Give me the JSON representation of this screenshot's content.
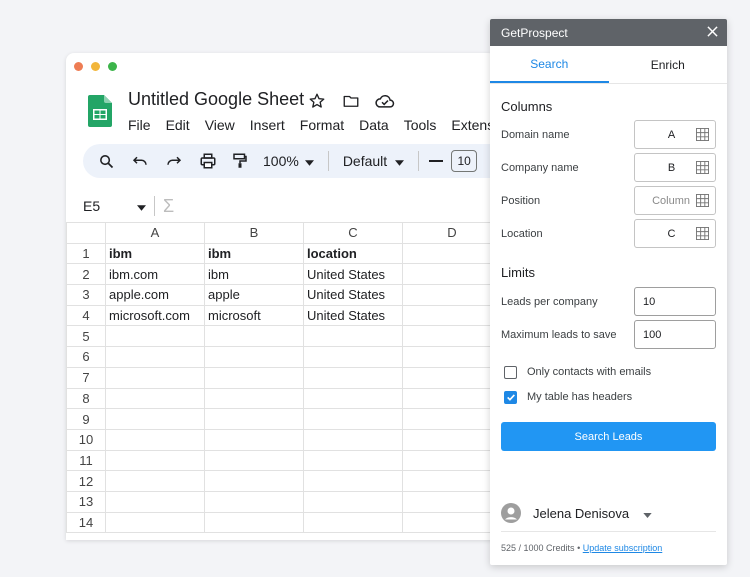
{
  "sheets": {
    "title": "Untitled Google Sheet",
    "menu": [
      "File",
      "Edit",
      "View",
      "Insert",
      "Format",
      "Data",
      "Tools",
      "Extensio"
    ],
    "toolbar": {
      "zoom": "100%",
      "font": "Default",
      "font_size": "10"
    },
    "name_box": "E5",
    "columns": [
      "A",
      "B",
      "C",
      "D"
    ],
    "rows": [
      {
        "n": "1",
        "cells": [
          "ibm",
          "ibm",
          "location",
          ""
        ]
      },
      {
        "n": "2",
        "cells": [
          "ibm.com",
          "ibm",
          "United States",
          ""
        ]
      },
      {
        "n": "3",
        "cells": [
          "apple.com",
          "apple",
          "United States",
          ""
        ]
      },
      {
        "n": "4",
        "cells": [
          "microsoft.com",
          "microsoft",
          "United States",
          ""
        ]
      },
      {
        "n": "5",
        "cells": [
          "",
          "",
          "",
          ""
        ]
      },
      {
        "n": "6",
        "cells": [
          "",
          "",
          "",
          ""
        ]
      },
      {
        "n": "7",
        "cells": [
          "",
          "",
          "",
          ""
        ]
      },
      {
        "n": "8",
        "cells": [
          "",
          "",
          "",
          ""
        ]
      },
      {
        "n": "9",
        "cells": [
          "",
          "",
          "",
          ""
        ]
      },
      {
        "n": "10",
        "cells": [
          "",
          "",
          "",
          ""
        ]
      },
      {
        "n": "11",
        "cells": [
          "",
          "",
          "",
          ""
        ]
      },
      {
        "n": "12",
        "cells": [
          "",
          "",
          "",
          ""
        ]
      },
      {
        "n": "13",
        "cells": [
          "",
          "",
          "",
          ""
        ]
      },
      {
        "n": "14",
        "cells": [
          "",
          "",
          "",
          ""
        ]
      }
    ]
  },
  "panel": {
    "title": "GetProspect",
    "tabs": [
      "Search",
      "Enrich"
    ],
    "columns_title": "Columns",
    "fields": [
      {
        "label": "Domain name",
        "value": "A",
        "placeholder": false
      },
      {
        "label": "Company name",
        "value": "B",
        "placeholder": false
      },
      {
        "label": "Position",
        "value": "Column",
        "placeholder": true
      },
      {
        "label": "Location",
        "value": "C",
        "placeholder": false
      }
    ],
    "limits_title": "Limits",
    "leads_per_company_label": "Leads per company",
    "leads_per_company": "10",
    "max_leads_label": "Maximum leads to save",
    "max_leads": "100",
    "only_emails_label": "Only contacts with emails",
    "only_emails_checked": false,
    "has_headers_label": "My table has headers",
    "has_headers_checked": true,
    "search_button": "Search Leads",
    "user_name": "Jelena Denisova",
    "credits": "525 / 1000 Credits",
    "credits_sep": "•",
    "update_link": "Update subscription"
  },
  "colors": {
    "accent": "#1e88e5",
    "header_bg": "#5f6368",
    "sheets_green": "#23a566"
  }
}
